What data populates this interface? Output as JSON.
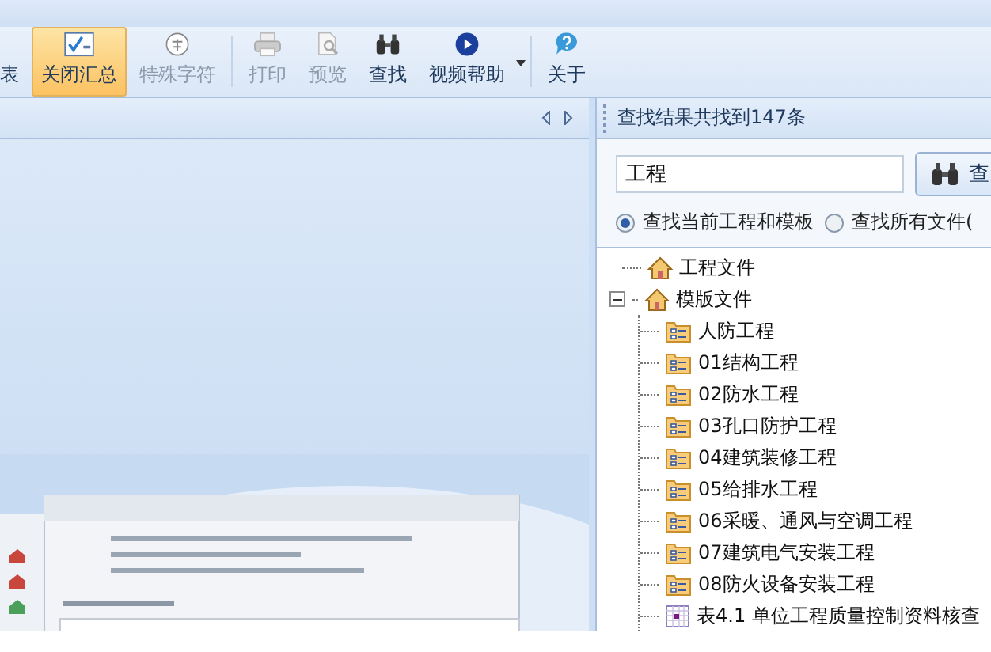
{
  "toolbar": {
    "items": [
      {
        "kind": "button",
        "label": "表",
        "selected": false,
        "disabled": false
      },
      {
        "kind": "button",
        "label": "关闭汇总",
        "selected": true,
        "disabled": false
      },
      {
        "kind": "button",
        "label": "特殊字符",
        "selected": false,
        "disabled": true
      },
      {
        "kind": "separator"
      },
      {
        "kind": "button",
        "label": "打印",
        "selected": false,
        "disabled": true
      },
      {
        "kind": "button",
        "label": "预览",
        "selected": false,
        "disabled": true
      },
      {
        "kind": "button",
        "label": "查找",
        "selected": false,
        "disabled": false
      },
      {
        "kind": "dropdown",
        "label": "视频帮助",
        "selected": false,
        "disabled": false
      },
      {
        "kind": "separator"
      },
      {
        "kind": "button",
        "label": "关于",
        "selected": false,
        "disabled": false
      }
    ]
  },
  "search_panel": {
    "title": "查找结果共找到147条",
    "field": {
      "value": "工程"
    },
    "button": {
      "label": "查"
    },
    "scope": [
      {
        "label": "查找当前工程和模板",
        "selected": true
      },
      {
        "label": "查找所有文件(",
        "selected": false
      }
    ],
    "tree": [
      {
        "kind": "house",
        "label": "工程文件"
      },
      {
        "kind": "house",
        "label": "模版文件",
        "expanded": true,
        "children": [
          {
            "kind": "folder",
            "label": "人防工程"
          },
          {
            "kind": "folder",
            "label": "01结构工程"
          },
          {
            "kind": "folder",
            "label": "02防水工程"
          },
          {
            "kind": "folder",
            "label": "03孔口防护工程"
          },
          {
            "kind": "folder",
            "label": "04建筑装修工程"
          },
          {
            "kind": "folder",
            "label": "05给排水工程"
          },
          {
            "kind": "folder",
            "label": "06采暖、通风与空调工程"
          },
          {
            "kind": "folder",
            "label": "07建筑电气安装工程"
          },
          {
            "kind": "folder",
            "label": "08防火设备安装工程"
          },
          {
            "kind": "table",
            "label": "表4.1  单位工程质量控制资料核查"
          }
        ]
      }
    ]
  }
}
